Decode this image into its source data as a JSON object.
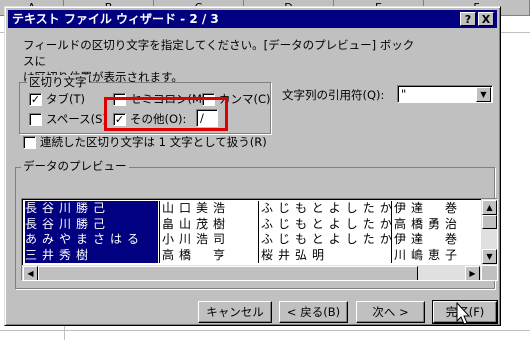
{
  "spreadsheet": {
    "columns": [
      "A",
      "B",
      "C",
      "D",
      "E",
      "F"
    ]
  },
  "dialog": {
    "title": "テキスト ファイル ウィザード - 2 / 3",
    "help_button": "?",
    "close_button": "X",
    "description_line1": "フィールドの区切り文字を指定してください。[データのプレビュー] ボックスに",
    "description_line2": "は区切り位置が表示されます。"
  },
  "delimiters": {
    "group_label": "区切り文字",
    "tab": {
      "label": "タブ(T)",
      "checked": true
    },
    "semicolon": {
      "label": "セミコロン(M)",
      "checked": false
    },
    "comma": {
      "label": "カンマ(C)",
      "checked": false
    },
    "space": {
      "label": "スペース(S)",
      "checked": false
    },
    "other": {
      "label": "その他(O):",
      "checked": true,
      "value": "/"
    }
  },
  "text_qualifier": {
    "label": "文字列の引用符(Q):",
    "value": "\""
  },
  "consecutive": {
    "label": "連続した区切り文字は 1 文字として扱う(R)",
    "checked": false
  },
  "preview": {
    "group_label": "データのプレビュー",
    "columns": [
      [
        "長谷川勝己",
        "長谷川勝己",
        "あみやまさはる",
        "三井秀樹"
      ],
      [
        "山口美浩",
        "畠山茂樹",
        "小川浩司",
        "高橋　亨"
      ],
      [
        "ふじもとよしたか",
        "ふじもとよしたか",
        "ふじもとよしたか",
        "桜井弘明"
      ],
      [
        "伊達　巻",
        "高橋勇治",
        "伊達　巻",
        "川嶋恵子"
      ]
    ]
  },
  "buttons": {
    "cancel": "キャンセル",
    "back": "< 戻る(B)",
    "next": "次へ >",
    "finish": "完了(F)"
  }
}
